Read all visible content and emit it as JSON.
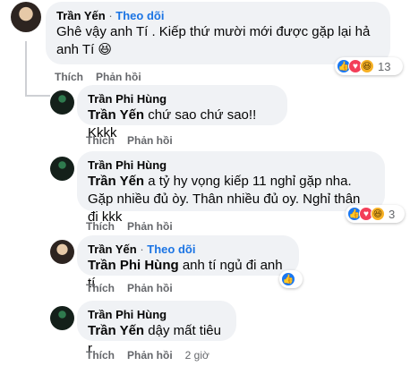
{
  "comments": [
    {
      "author": "Trần Yến",
      "follow": "Theo dõi",
      "text": "Ghê vậy anh Tí . Kiếp thứ mười mới được gặp lại hả anh Tí 😆",
      "actions": [
        "Thích",
        "Phản hồi"
      ],
      "reaction_count": "13"
    },
    {
      "author": "Trần Phi Hùng",
      "mention": "Trần Yến",
      "text": " chứ sao chứ sao!! Kkkk",
      "actions": [
        "Thích",
        "Phản hồi"
      ]
    },
    {
      "author": "Trần Phi Hùng",
      "mention": "Trần Yến",
      "text": " a tỷ hy vọng kiếp 11 nghỉ gặp nha. Gặp nhiều đủ òy. Thân nhiều đủ oy. Nghỉ thân đi kkk",
      "actions": [
        "Thích",
        "Phản hồi"
      ],
      "reaction_count": "3"
    },
    {
      "author": "Trần Yến",
      "follow": "Theo dõi",
      "mention": "Trần Phi Hùng",
      "text": " anh tí ngủ đi anh tí",
      "actions": [
        "Thích",
        "Phản hồi"
      ]
    },
    {
      "author": "Trần Phi Hùng",
      "mention": "Trần Yến",
      "text": " dậy mất tiêu r",
      "actions": [
        "Thích",
        "Phản hồi"
      ],
      "time": "2 giờ"
    }
  ],
  "colors": {
    "link": "#1b74e4",
    "bubble": "#f0f2f5",
    "meta": "#65676b"
  }
}
